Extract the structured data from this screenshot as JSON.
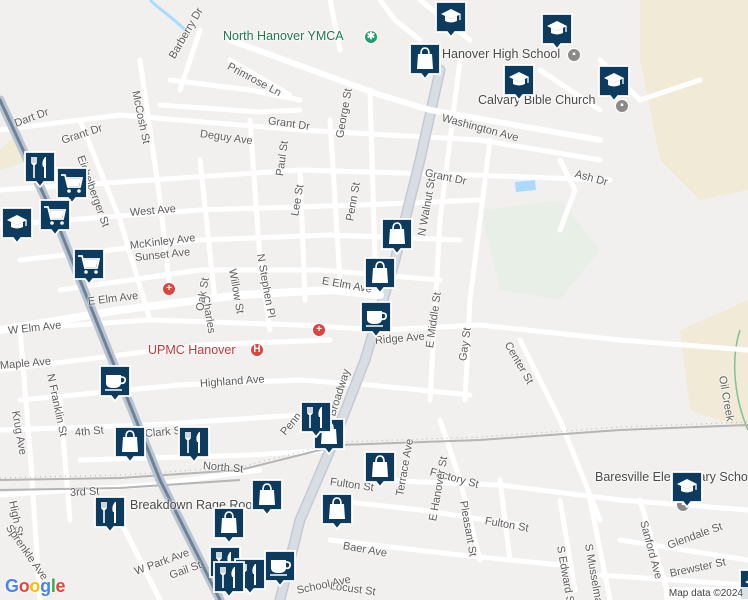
{
  "map": {
    "attribution": "Map data ©2024",
    "google_logo": [
      "G",
      "o",
      "o",
      "g",
      "l",
      "e"
    ],
    "google_colors": [
      "#4285f4",
      "#ea4335",
      "#fbbc05",
      "#4285f4",
      "#34a853",
      "#ea4335"
    ]
  },
  "colors": {
    "marker": "#0d3b5e",
    "park": "#d7eedb",
    "sand": "#f1ead6",
    "water": "#aadaff",
    "rail": "#a8a8a8"
  },
  "poi_labels": [
    {
      "id": "ymca",
      "text": "North Hanover YMCA",
      "style": "green"
    },
    {
      "id": "hs",
      "text": "Hanover High School",
      "style": "gray"
    },
    {
      "id": "church",
      "text": "Calvary Bible Church",
      "style": "gray"
    },
    {
      "id": "upmc",
      "text": "UPMC Hanover",
      "style": "red"
    },
    {
      "id": "bares",
      "text": "Baresville Elementary School",
      "style": "gray"
    },
    {
      "id": "rage",
      "text": "Breakdown Rage Room",
      "style": "gray"
    }
  ],
  "streets": [
    {
      "text": "Barberry Dr"
    },
    {
      "text": "Primrose Ln"
    },
    {
      "text": "Dart Dr"
    },
    {
      "text": "Grant Dr"
    },
    {
      "text": "Deguy Ave"
    },
    {
      "text": "McCosh St"
    },
    {
      "text": "Eichelberger St"
    },
    {
      "text": "Grant Dr"
    },
    {
      "text": "Washington Ave"
    },
    {
      "text": "Grant Dr"
    },
    {
      "text": "George St"
    },
    {
      "text": "Paul St"
    },
    {
      "text": "Ash Dr"
    },
    {
      "text": "West Ave"
    },
    {
      "text": "McKinley Ave"
    },
    {
      "text": "Lee St"
    },
    {
      "text": "Penn St"
    },
    {
      "text": "N Walnut St"
    },
    {
      "text": "Sunset Ave"
    },
    {
      "text": "N Stephen Pl"
    },
    {
      "text": "Willow St"
    },
    {
      "text": "E Elm Ave"
    },
    {
      "text": "E Elm Ave"
    },
    {
      "text": "W Elm Ave"
    },
    {
      "text": "Charles"
    },
    {
      "text": "Oak St"
    },
    {
      "text": "Maple Ave"
    },
    {
      "text": "N Franklin St"
    },
    {
      "text": "Ridge Ave"
    },
    {
      "text": "E Middle St"
    },
    {
      "text": "Gay St"
    },
    {
      "text": "Center St"
    },
    {
      "text": "Highland Ave"
    },
    {
      "text": "Krug Ave"
    },
    {
      "text": "4th St"
    },
    {
      "text": "Clark St"
    },
    {
      "text": "North St"
    },
    {
      "text": "Penn"
    },
    {
      "text": "Broadway"
    },
    {
      "text": "Fulton St"
    },
    {
      "text": "Factory St"
    },
    {
      "text": "3rd St"
    },
    {
      "text": "High St"
    },
    {
      "text": "Terrace Ave"
    },
    {
      "text": "E Hanover St"
    },
    {
      "text": "Pleasant St"
    },
    {
      "text": "Fulton St"
    },
    {
      "text": "Sprenkle Ave"
    },
    {
      "text": "Baer Ave"
    },
    {
      "text": "W Park Ave"
    },
    {
      "text": "Gail St"
    },
    {
      "text": "Locust St"
    },
    {
      "text": "School Ave"
    },
    {
      "text": "S Edward St"
    },
    {
      "text": "S Musselman"
    },
    {
      "text": "Sanford Ave"
    },
    {
      "text": "Glendale St"
    },
    {
      "text": "Brewster St"
    },
    {
      "text": "Oil Creek"
    }
  ],
  "markers": [
    {
      "type": "school"
    },
    {
      "type": "school"
    },
    {
      "type": "school"
    },
    {
      "type": "school"
    },
    {
      "type": "school"
    },
    {
      "type": "shopping"
    },
    {
      "type": "shopping"
    },
    {
      "type": "shopping"
    },
    {
      "type": "shopping"
    },
    {
      "type": "shopping"
    },
    {
      "type": "shopping"
    },
    {
      "type": "shopping"
    },
    {
      "type": "shopping"
    },
    {
      "type": "shopping"
    },
    {
      "type": "shopping"
    },
    {
      "type": "grocery"
    },
    {
      "type": "grocery"
    },
    {
      "type": "grocery"
    },
    {
      "type": "restaurant"
    },
    {
      "type": "restaurant"
    },
    {
      "type": "restaurant"
    },
    {
      "type": "restaurant"
    },
    {
      "type": "restaurant"
    },
    {
      "type": "restaurant"
    },
    {
      "type": "restaurant"
    },
    {
      "type": "cafe"
    },
    {
      "type": "cafe"
    },
    {
      "type": "cafe"
    },
    {
      "type": "cafe"
    },
    {
      "type": "cafe"
    },
    {
      "type": "school"
    },
    {
      "type": "school"
    }
  ]
}
